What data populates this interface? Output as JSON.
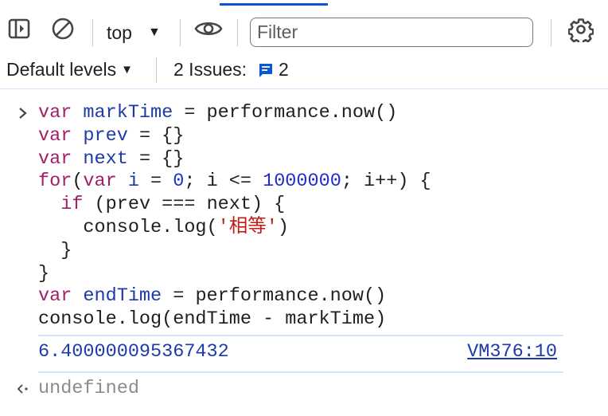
{
  "toolbar": {
    "context": "top",
    "filter_placeholder": "Filter"
  },
  "toolbar2": {
    "levels_label": "Default levels",
    "issues_label": "2 Issues:",
    "issues_count": "2"
  },
  "console": {
    "code_lines": [
      [
        {
          "t": "var",
          "c": "kw-var"
        },
        {
          "t": " ",
          "c": "plain"
        },
        {
          "t": "markTime",
          "c": "var"
        },
        {
          "t": " = performance.now()",
          "c": "plain"
        }
      ],
      [
        {
          "t": "var",
          "c": "kw-var"
        },
        {
          "t": " ",
          "c": "plain"
        },
        {
          "t": "prev",
          "c": "var"
        },
        {
          "t": " = {}",
          "c": "plain"
        }
      ],
      [
        {
          "t": "var",
          "c": "kw-var"
        },
        {
          "t": " ",
          "c": "plain"
        },
        {
          "t": "next",
          "c": "var"
        },
        {
          "t": " = {}",
          "c": "plain"
        }
      ],
      [
        {
          "t": "for",
          "c": "kw-var"
        },
        {
          "t": "(",
          "c": "plain"
        },
        {
          "t": "var",
          "c": "kw-var"
        },
        {
          "t": " ",
          "c": "plain"
        },
        {
          "t": "i",
          "c": "var"
        },
        {
          "t": " = ",
          "c": "plain"
        },
        {
          "t": "0",
          "c": "num"
        },
        {
          "t": "; i <= ",
          "c": "plain"
        },
        {
          "t": "1000000",
          "c": "num"
        },
        {
          "t": "; i++) {",
          "c": "plain"
        }
      ],
      [
        {
          "t": "  ",
          "c": "plain"
        },
        {
          "t": "if",
          "c": "kw-var"
        },
        {
          "t": " (prev === next) {",
          "c": "plain"
        }
      ],
      [
        {
          "t": "    console.log(",
          "c": "plain"
        },
        {
          "t": "'相等'",
          "c": "str"
        },
        {
          "t": ")",
          "c": "plain"
        }
      ],
      [
        {
          "t": "  }",
          "c": "plain"
        }
      ],
      [
        {
          "t": "}",
          "c": "plain"
        }
      ],
      [
        {
          "t": "var",
          "c": "kw-var"
        },
        {
          "t": " ",
          "c": "plain"
        },
        {
          "t": "endTime",
          "c": "var"
        },
        {
          "t": " = performance.now()",
          "c": "plain"
        }
      ],
      [
        {
          "t": "console.log(endTime - markTime)",
          "c": "plain"
        }
      ]
    ],
    "result_value": "6.400000095367432",
    "result_source": "VM376:10",
    "return_value": "undefined"
  },
  "colors": {
    "accent": "#0b57d0",
    "keyword": "#a11f69",
    "variable": "#1d3aa8",
    "string": "#c41a16"
  }
}
